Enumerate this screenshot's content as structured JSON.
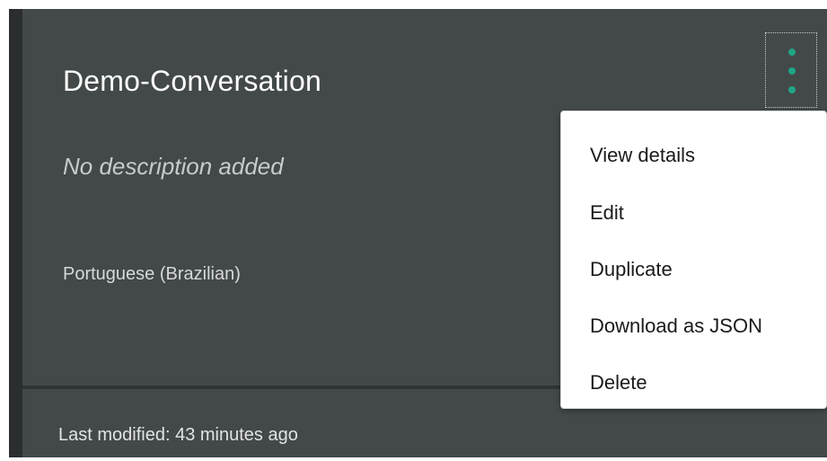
{
  "card": {
    "title": "Demo-Conversation",
    "description": "No description added",
    "language": "Portuguese (Brazilian)",
    "last_modified": "Last modified: 43 minutes ago"
  },
  "overflow_menu": {
    "icon": "kebab-vertical-icon",
    "items": [
      {
        "label": "View details"
      },
      {
        "label": "Edit"
      },
      {
        "label": "Duplicate"
      },
      {
        "label": "Download as JSON"
      },
      {
        "label": "Delete"
      }
    ]
  },
  "colors": {
    "card_background": "#434849",
    "card_accent_border": "#2a2e2f",
    "kebab_dots": "#1fa585",
    "menu_background": "#ffffff"
  }
}
